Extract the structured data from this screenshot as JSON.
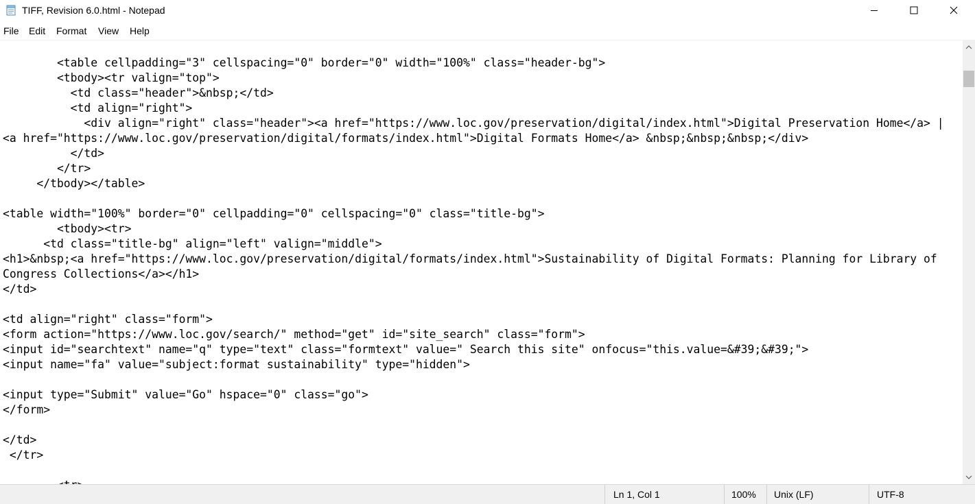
{
  "window": {
    "title": "TIFF, Revision 6.0.html - Notepad",
    "icon": "notepad-icon",
    "controls": [
      "minimize-icon",
      "maximize-icon",
      "close-icon"
    ]
  },
  "menu": {
    "file": "File",
    "edit": "Edit",
    "format": "Format",
    "view": "View",
    "help": "Help"
  },
  "editor": {
    "lines": [
      "        <table cellpadding=\"3\" cellspacing=\"0\" border=\"0\" width=\"100%\" class=\"header-bg\">",
      "        <tbody><tr valign=\"top\">",
      "          <td class=\"header\">&nbsp;</td>",
      "          <td align=\"right\">",
      "            <div align=\"right\" class=\"header\"><a href=\"https://www.loc.gov/preservation/digital/index.html\">Digital Preservation Home</a> |",
      "<a href=\"https://www.loc.gov/preservation/digital/formats/index.html\">Digital Formats Home</a> &nbsp;&nbsp;&nbsp;</div>",
      "          </td>",
      "        </tr>",
      "     </tbody></table>",
      "",
      "<table width=\"100%\" border=\"0\" cellpadding=\"0\" cellspacing=\"0\" class=\"title-bg\">",
      "        <tbody><tr>",
      "      <td class=\"title-bg\" align=\"left\" valign=\"middle\">",
      "<h1>&nbsp;<a href=\"https://www.loc.gov/preservation/digital/formats/index.html\">Sustainability of Digital Formats: Planning for Library of",
      "Congress Collections</a></h1>",
      "</td>",
      "",
      "<td align=\"right\" class=\"form\">",
      "<form action=\"https://www.loc.gov/search/\" method=\"get\" id=\"site_search\" class=\"form\">",
      "<input id=\"searchtext\" name=\"q\" type=\"text\" class=\"formtext\" value=\" Search this site\" onfocus=\"this.value=&#39;&#39;\">",
      "<input name=\"fa\" value=\"subject:format sustainability\" type=\"hidden\">",
      "",
      "<input type=\"Submit\" value=\"Go\" hspace=\"0\" class=\"go\">",
      "</form>",
      "",
      "</td>",
      " </tr>",
      "",
      "        <tr>"
    ]
  },
  "scrollbar": {
    "up": "chevron-up-icon",
    "down": "chevron-down-icon"
  },
  "status": {
    "position": "Ln 1, Col 1",
    "zoom": "100%",
    "line_ending": "Unix (LF)",
    "encoding": "UTF-8"
  }
}
